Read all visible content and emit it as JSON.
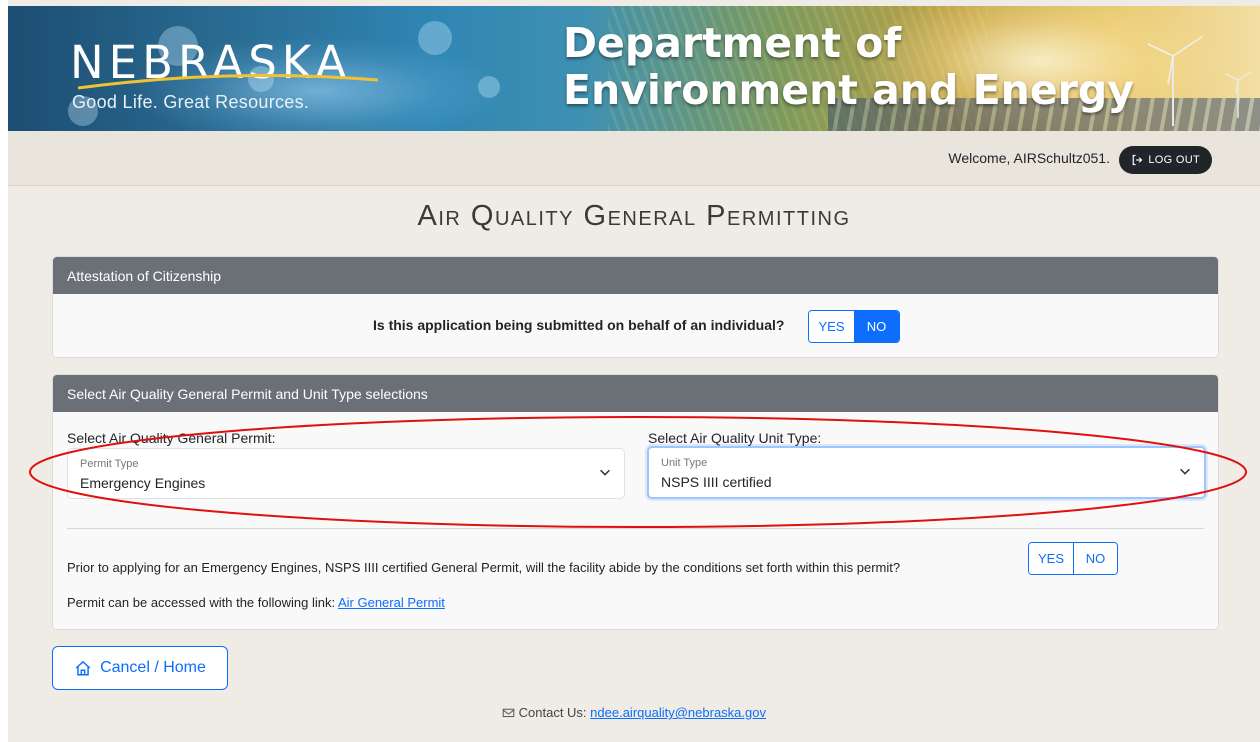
{
  "banner": {
    "state_name": "NEBRASKA",
    "tagline": "Good Life. Great Resources.",
    "department_line1": "Department of",
    "department_line2": "Environment and Energy"
  },
  "userbar": {
    "welcome": "Welcome, AIRSchultz051.",
    "logout_label": "LOG OUT"
  },
  "page_title": "Air Quality General Permitting",
  "citizenship": {
    "header": "Attestation of Citizenship",
    "question": "Is this application being submitted on behalf of an individual?",
    "yes_label": "YES",
    "no_label": "NO"
  },
  "selection": {
    "header": "Select Air Quality General Permit and Unit Type selections",
    "permit_label": "Select Air Quality General Permit:",
    "permit_caption": "Permit Type",
    "permit_value": "Emergency Engines",
    "unit_label": "Select Air Quality Unit Type:",
    "unit_caption": "Unit Type",
    "unit_value": "NSPS IIII certified",
    "abide_question": "Prior to applying for an Emergency Engines, NSPS IIII certified General Permit, will the facility abide by the conditions set forth within this permit?",
    "yes_label": "YES",
    "no_label": "NO",
    "link_prefix": "Permit can be accessed with the following link:",
    "link_text": "Air General Permit"
  },
  "cancel_label": "Cancel / Home",
  "contact": {
    "prefix": "Contact Us:",
    "email": "ndee.airquality@nebraska.gov"
  },
  "colors": {
    "primary": "#0d6efd",
    "card_header": "#6b7076",
    "annotation": "#e0100f"
  }
}
